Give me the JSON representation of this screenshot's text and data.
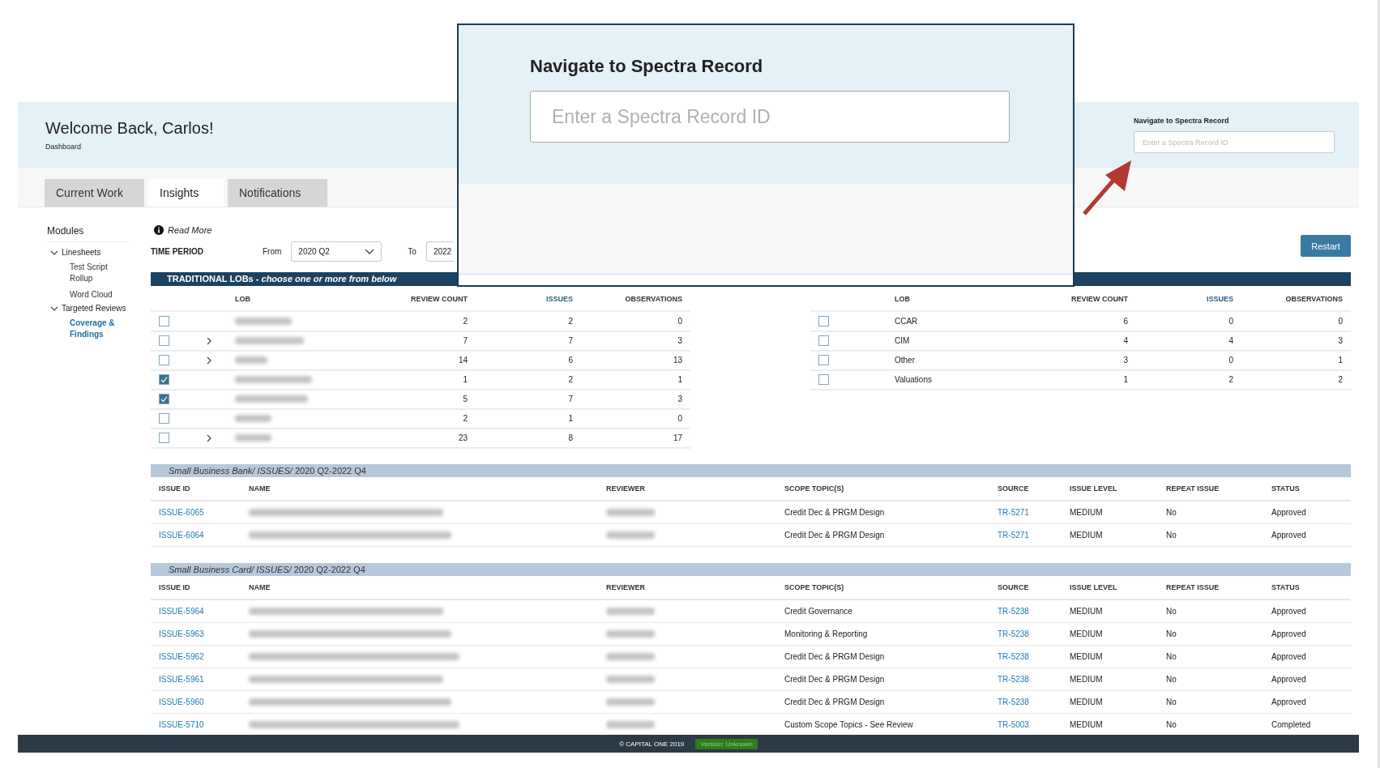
{
  "callout": {
    "title": "Navigate to Spectra Record",
    "placeholder": "Enter a Spectra Record ID"
  },
  "header": {
    "title": "Welcome Back, Carlos!",
    "subtitle": "Dashboard",
    "record_search": {
      "label": "Navigate to Spectra Record",
      "placeholder": "Enter a Spectra Record ID"
    }
  },
  "tabs": [
    {
      "label": "Current Work",
      "selected": false
    },
    {
      "label": "Insights",
      "selected": true
    },
    {
      "label": "Notifications",
      "selected": false
    }
  ],
  "sidebar": {
    "title": "Modules",
    "items": [
      {
        "label": "Linesheets",
        "expanded": true,
        "children": [
          {
            "label": "Test Script Rollup",
            "selected": false
          },
          {
            "label": "Word Cloud",
            "selected": false
          }
        ]
      },
      {
        "label": "Targeted Reviews",
        "expanded": true,
        "children": [
          {
            "label": "Coverage & Findings",
            "selected": true
          }
        ]
      }
    ]
  },
  "read_more": "Read More",
  "time_period": {
    "label": "TIME PERIOD",
    "from_label": "From",
    "from_value": "2020 Q2",
    "to_label": "To",
    "to_value": "2022"
  },
  "restart_button": "Restart",
  "lob_banner": "TRADITIONAL LOBs - *choose one or more from below*",
  "lob_tables": [
    {
      "columns": [
        {
          "label": "LOB",
          "link": false
        },
        {
          "label": "REVIEW COUNT",
          "link": false
        },
        {
          "label": "ISSUES",
          "link": true
        },
        {
          "label": "OBSERVATIONS",
          "link": false
        }
      ],
      "rows": [
        {
          "checked": false,
          "expandable": false,
          "lob_blurred": true,
          "review_count": "2",
          "issues": "2",
          "observations": "0"
        },
        {
          "checked": false,
          "expandable": true,
          "lob_blurred": true,
          "review_count": "7",
          "issues": "7",
          "observations": "3"
        },
        {
          "checked": false,
          "expandable": true,
          "lob_blurred": true,
          "review_count": "14",
          "issues": "6",
          "observations": "13"
        },
        {
          "checked": true,
          "expandable": false,
          "lob_blurred": true,
          "review_count": "1",
          "issues": "2",
          "observations": "1"
        },
        {
          "checked": true,
          "expandable": false,
          "lob_blurred": true,
          "review_count": "5",
          "issues": "7",
          "observations": "3"
        },
        {
          "checked": false,
          "expandable": false,
          "lob_blurred": true,
          "review_count": "2",
          "issues": "1",
          "observations": "0"
        },
        {
          "checked": false,
          "expandable": true,
          "lob_blurred": true,
          "review_count": "23",
          "issues": "8",
          "observations": "17"
        }
      ]
    },
    {
      "columns": [
        {
          "label": "LOB",
          "link": false
        },
        {
          "label": "REVIEW COUNT",
          "link": false
        },
        {
          "label": "ISSUES",
          "link": true
        },
        {
          "label": "OBSERVATIONS",
          "link": false
        }
      ],
      "rows": [
        {
          "checked": false,
          "expandable": false,
          "lob_blurred": false,
          "lob": "CCAR",
          "review_count": "6",
          "issues": "0",
          "observations": "0"
        },
        {
          "checked": false,
          "expandable": false,
          "lob_blurred": false,
          "lob": "CIM",
          "review_count": "4",
          "issues": "4",
          "observations": "3"
        },
        {
          "checked": false,
          "expandable": false,
          "lob_blurred": false,
          "lob": "Other",
          "review_count": "3",
          "issues": "0",
          "observations": "1"
        },
        {
          "checked": false,
          "expandable": false,
          "lob_blurred": false,
          "lob": "Valuations",
          "review_count": "1",
          "issues": "2",
          "observations": "2"
        }
      ]
    }
  ],
  "issue_sections": [
    {
      "title": "*Small Business Bank/ ISSUES/* 2020 Q2-2022 Q4",
      "columns": [
        "ISSUE ID",
        "NAME",
        "REVIEWER",
        "SCOPE TOPIC(S)",
        "SOURCE",
        "ISSUE LEVEL",
        "REPEAT ISSUE",
        "STATUS"
      ],
      "rows": [
        {
          "id": "ISSUE-6065",
          "blurred": true,
          "scope": "Credit Dec & PRGM Design",
          "source": "TR-5271",
          "level": "MEDIUM",
          "repeat": "No",
          "status": "Approved"
        },
        {
          "id": "ISSUE-6064",
          "blurred": true,
          "scope": "Credit Dec & PRGM Design",
          "source": "TR-5271",
          "level": "MEDIUM",
          "repeat": "No",
          "status": "Approved"
        }
      ]
    },
    {
      "title": "*Small Business Card/ ISSUES/* 2020 Q2-2022 Q4",
      "columns": [
        "ISSUE ID",
        "NAME",
        "REVIEWER",
        "SCOPE TOPIC(S)",
        "SOURCE",
        "ISSUE LEVEL",
        "REPEAT ISSUE",
        "STATUS"
      ],
      "rows": [
        {
          "id": "ISSUE-5964",
          "blurred": true,
          "scope": "Credit Governance",
          "source": "TR-5238",
          "level": "MEDIUM",
          "repeat": "No",
          "status": "Approved"
        },
        {
          "id": "ISSUE-5963",
          "blurred": true,
          "scope": "Monitoring & Reporting",
          "source": "TR-5238",
          "level": "MEDIUM",
          "repeat": "No",
          "status": "Approved"
        },
        {
          "id": "ISSUE-5962",
          "blurred": true,
          "scope": "Credit Dec & PRGM Design",
          "source": "TR-5238",
          "level": "MEDIUM",
          "repeat": "No",
          "status": "Approved"
        },
        {
          "id": "ISSUE-5961",
          "blurred": true,
          "scope": "Credit Dec & PRGM Design",
          "source": "TR-5238",
          "level": "MEDIUM",
          "repeat": "No",
          "status": "Approved"
        },
        {
          "id": "ISSUE-5960",
          "blurred": true,
          "scope": "Credit Dec & PRGM Design",
          "source": "TR-5238",
          "level": "MEDIUM",
          "repeat": "No",
          "status": "Approved"
        },
        {
          "id": "ISSUE-5710",
          "blurred": true,
          "scope": "Custom Scope Topics - See Review",
          "source": "TR-5003",
          "level": "MEDIUM",
          "repeat": "No",
          "status": "Completed"
        }
      ]
    }
  ],
  "footer": {
    "copyright": "© CAPITAL ONE 2019",
    "version": "Version: Unknown"
  }
}
